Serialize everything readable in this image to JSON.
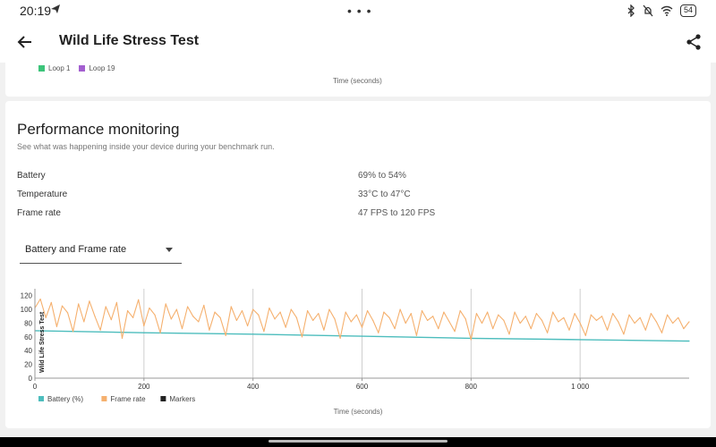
{
  "status_bar": {
    "time": "20:19",
    "more": "• • •",
    "battery": "54"
  },
  "app_bar": {
    "title": "Wild Life Stress Test"
  },
  "previous_chart": {
    "legend": [
      {
        "label": "Loop 1",
        "color": "#3cc47a"
      },
      {
        "label": "Loop 19",
        "color": "#a35fd0"
      }
    ],
    "x_caption": "Time (seconds)"
  },
  "monitoring": {
    "title": "Performance monitoring",
    "subtitle": "See what was happening inside your device during your benchmark run.",
    "metrics": [
      {
        "label": "Battery",
        "value": "69% to 54%"
      },
      {
        "label": "Temperature",
        "value": "33°C to 47°C"
      },
      {
        "label": "Frame rate",
        "value": "47 FPS to 120 FPS"
      }
    ],
    "dropdown": {
      "selected": "Battery and Frame rate"
    }
  },
  "chart_data": {
    "type": "line",
    "ylabel": "Wild Life Stress Test",
    "xlabel": "Time (seconds)",
    "xlim": [
      0,
      1200
    ],
    "ylim": [
      0,
      130
    ],
    "xticks": [
      0,
      200,
      400,
      600,
      800,
      1000
    ],
    "xtick_labels": [
      "0",
      "200",
      "400",
      "600",
      "800",
      "1 000"
    ],
    "yticks": [
      0,
      20,
      40,
      60,
      80,
      100,
      120
    ],
    "vertical_gridlines_at": [
      200,
      400,
      600,
      800,
      1000
    ],
    "legend": [
      {
        "label": "Battery (%)",
        "color": "#4dbdbd"
      },
      {
        "label": "Frame rate",
        "color": "#f5b06e"
      },
      {
        "label": "Markers",
        "color": "#222222"
      }
    ],
    "series": [
      {
        "name": "Battery (%)",
        "color": "#4dbdbd",
        "x": [
          0,
          200,
          400,
          600,
          800,
          1000,
          1200
        ],
        "y": [
          69,
          66,
          64,
          61,
          58,
          56,
          54
        ]
      },
      {
        "name": "Frame rate",
        "color": "#f5b06e",
        "x": [
          0,
          10,
          20,
          30,
          40,
          50,
          60,
          70,
          80,
          90,
          100,
          110,
          120,
          130,
          140,
          150,
          160,
          170,
          180,
          190,
          200,
          210,
          220,
          230,
          240,
          250,
          260,
          270,
          280,
          290,
          300,
          310,
          320,
          330,
          340,
          350,
          360,
          370,
          380,
          390,
          400,
          410,
          420,
          430,
          440,
          450,
          460,
          470,
          480,
          490,
          500,
          510,
          520,
          530,
          540,
          550,
          560,
          570,
          580,
          590,
          600,
          610,
          620,
          630,
          640,
          650,
          660,
          670,
          680,
          690,
          700,
          710,
          720,
          730,
          740,
          750,
          760,
          770,
          780,
          790,
          800,
          810,
          820,
          830,
          840,
          850,
          860,
          870,
          880,
          890,
          900,
          910,
          920,
          930,
          940,
          950,
          960,
          970,
          980,
          990,
          1000,
          1010,
          1020,
          1030,
          1040,
          1050,
          1060,
          1070,
          1080,
          1090,
          1100,
          1110,
          1120,
          1130,
          1140,
          1150,
          1160,
          1170,
          1180,
          1190,
          1200
        ],
        "y": [
          102,
          115,
          88,
          110,
          75,
          105,
          95,
          68,
          108,
          82,
          112,
          90,
          70,
          104,
          85,
          110,
          58,
          98,
          88,
          114,
          76,
          102,
          92,
          66,
          108,
          86,
          100,
          72,
          104,
          90,
          82,
          106,
          70,
          96,
          88,
          62,
          104,
          84,
          98,
          76,
          100,
          92,
          68,
          102,
          86,
          96,
          74,
          100,
          88,
          60,
          98,
          84,
          94,
          70,
          100,
          86,
          58,
          96,
          82,
          92,
          74,
          98,
          84,
          66,
          96,
          88,
          72,
          100,
          80,
          94,
          62,
          98,
          84,
          90,
          72,
          96,
          82,
          68,
          98,
          86,
          56,
          94,
          80,
          96,
          72,
          92,
          84,
          64,
          96,
          80,
          90,
          72,
          94,
          84,
          66,
          96,
          82,
          88,
          70,
          94,
          80,
          62,
          92,
          84,
          90,
          70,
          94,
          82,
          64,
          92,
          80,
          88,
          70,
          94,
          82,
          66,
          92,
          80,
          88,
          72,
          82
        ]
      }
    ]
  }
}
